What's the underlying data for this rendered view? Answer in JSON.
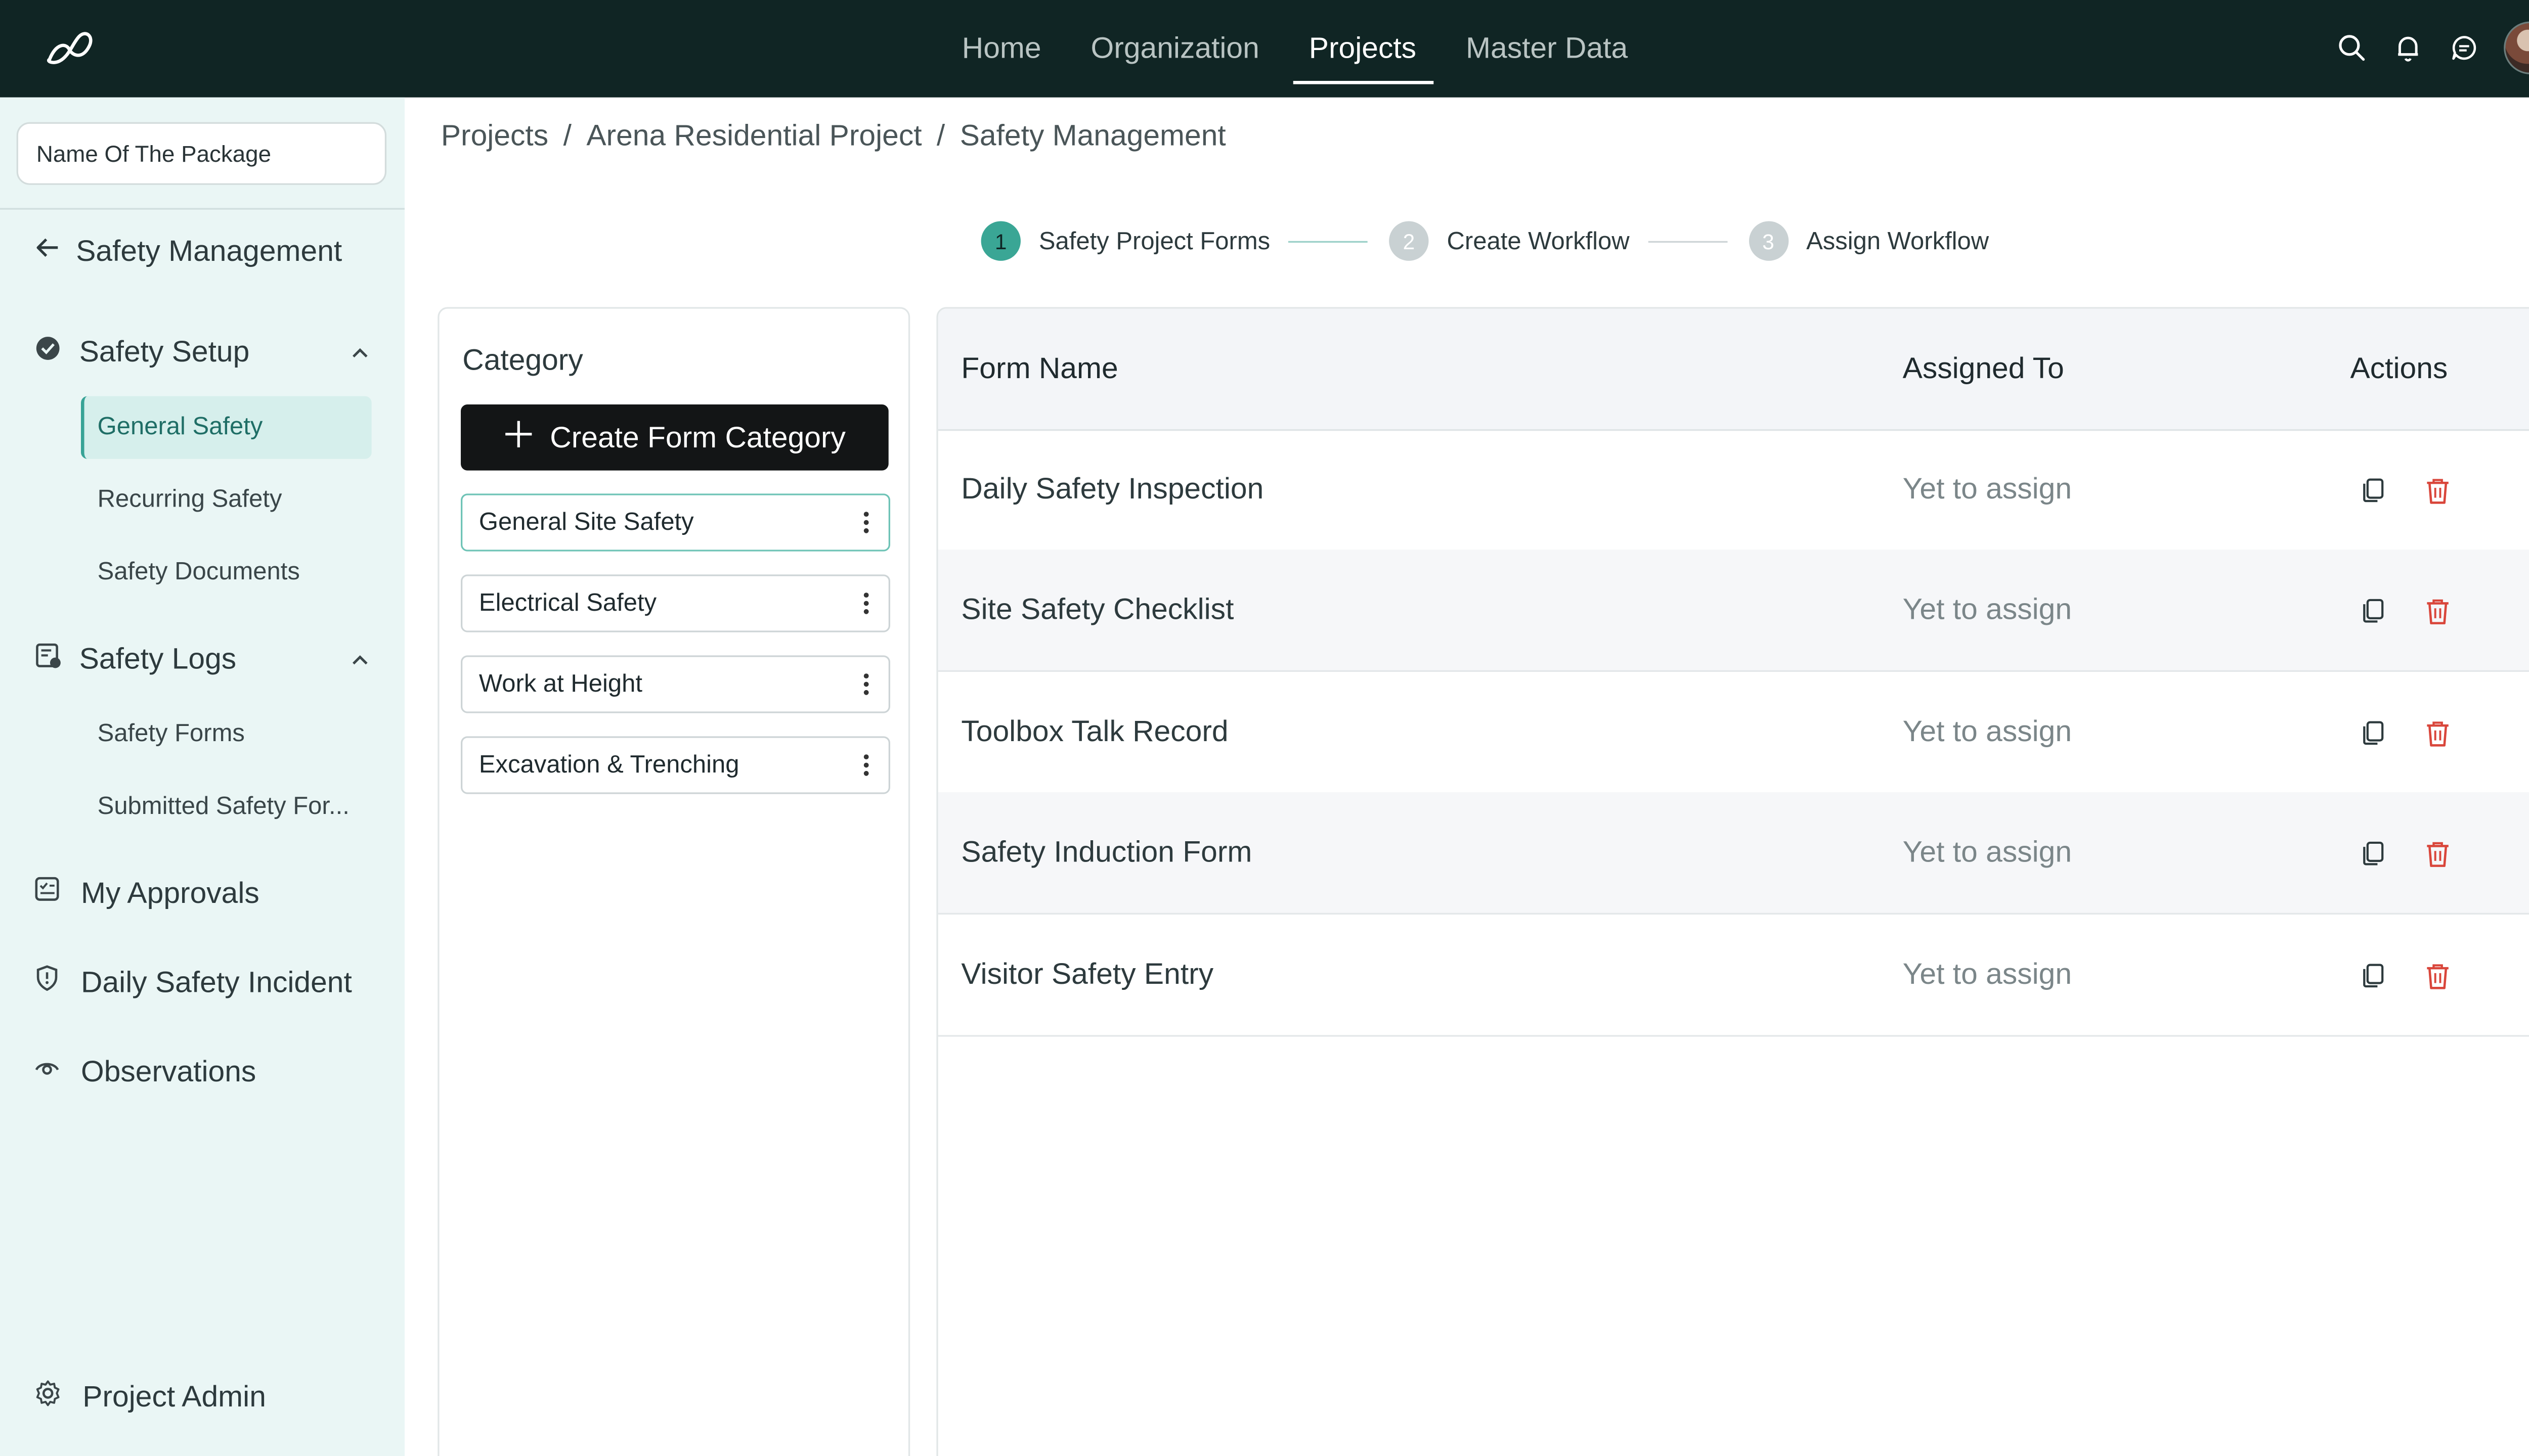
{
  "topnav": {
    "items": [
      {
        "label": "Home",
        "active": false
      },
      {
        "label": "Organization",
        "active": false
      },
      {
        "label": "Projects",
        "active": true
      },
      {
        "label": "Master Data",
        "active": false
      }
    ],
    "icons": [
      "search-icon",
      "bell-icon",
      "chat-icon",
      "avatar"
    ]
  },
  "sidebar": {
    "package_input": {
      "value": "Name Of The Package"
    },
    "back_label": "Safety Management",
    "safety_setup": {
      "label": "Safety Setup",
      "items": [
        {
          "label": "General Safety",
          "active": true
        },
        {
          "label": "Recurring Safety",
          "active": false
        },
        {
          "label": "Safety Documents",
          "active": false
        }
      ]
    },
    "safety_logs": {
      "label": "Safety Logs",
      "items": [
        {
          "label": "Safety Forms"
        },
        {
          "label": "Submitted Safety For..."
        }
      ]
    },
    "my_approvals": "My Approvals",
    "daily_incident": "Daily Safety Incident",
    "observations": "Observations",
    "project_admin": "Project Admin"
  },
  "breadcrumb": {
    "items": [
      "Projects",
      "Arena Residential Project",
      "Safety Management"
    ],
    "separator": "/"
  },
  "stepper": {
    "steps": [
      {
        "num": "1",
        "label": "Safety Project Forms",
        "active": true
      },
      {
        "num": "2",
        "label": "Create Workflow",
        "active": false
      },
      {
        "num": "3",
        "label": "Assign Workflow",
        "active": false
      }
    ]
  },
  "category": {
    "title": "Category",
    "create_label": "Create Form Category",
    "items": [
      {
        "label": "General Site Safety",
        "active": true
      },
      {
        "label": "Electrical Safety",
        "active": false
      },
      {
        "label": "Work at Height",
        "active": false
      },
      {
        "label": "Excavation & Trenching",
        "active": false
      }
    ]
  },
  "table": {
    "headers": {
      "name": "Form Name",
      "assigned": "Assigned To",
      "actions": "Actions"
    },
    "rows": [
      {
        "name": "Daily Safety Inspection",
        "assigned": "Yet to assign"
      },
      {
        "name": "Site Safety Checklist",
        "assigned": "Yet to assign"
      },
      {
        "name": "Toolbox Talk Record",
        "assigned": "Yet to assign"
      },
      {
        "name": "Safety Induction Form",
        "assigned": "Yet to assign"
      },
      {
        "name": "Visitor Safety Entry",
        "assigned": "Yet to assign"
      }
    ]
  },
  "colors": {
    "topbar": "#102524",
    "sidebar": "#eaf6f5",
    "accent": "#3aa695",
    "danger": "#d9463b"
  }
}
